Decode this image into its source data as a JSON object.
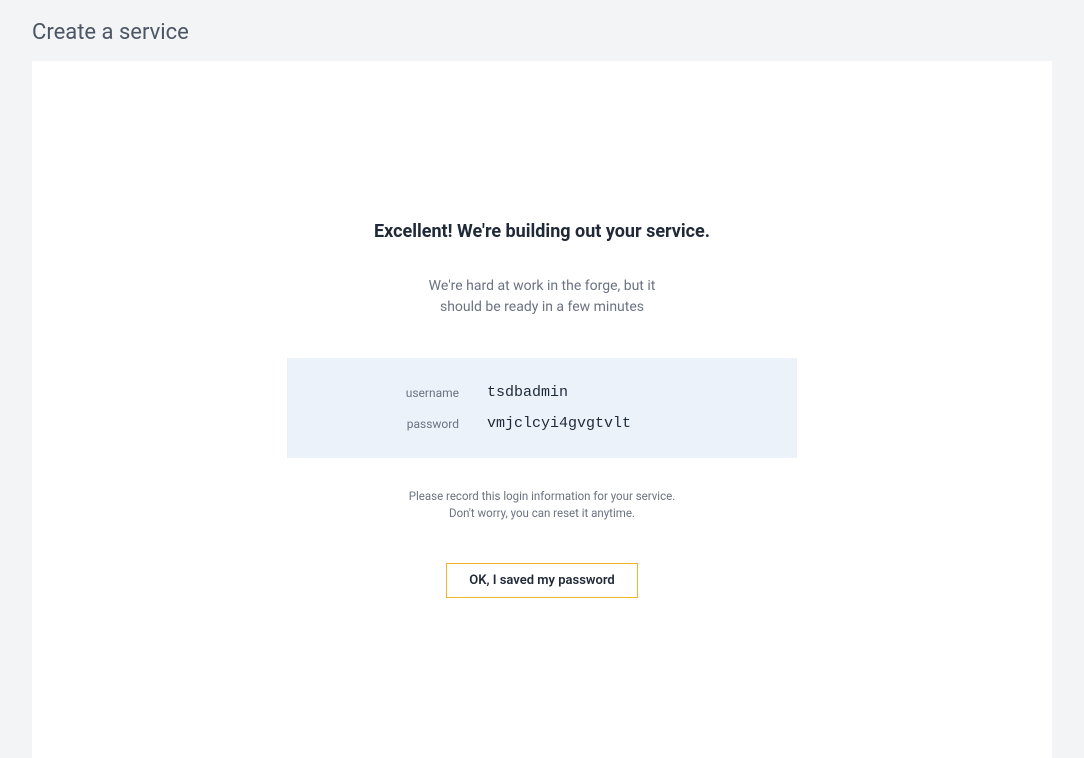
{
  "page": {
    "title": "Create a service"
  },
  "main": {
    "heading": "Excellent! We're building out your service.",
    "subtext_line1": "We're hard at work in the forge, but it",
    "subtext_line2": "should be ready in a few minutes"
  },
  "credentials": {
    "username_label": "username",
    "username_value": "tsdbadmin",
    "password_label": "password",
    "password_value": "vmjclcyi4gvgtvlt"
  },
  "info": {
    "line1": "Please record this login information for your service.",
    "line2": "Don't worry, you can reset it anytime."
  },
  "buttons": {
    "confirm_label": "OK, I saved my password"
  }
}
